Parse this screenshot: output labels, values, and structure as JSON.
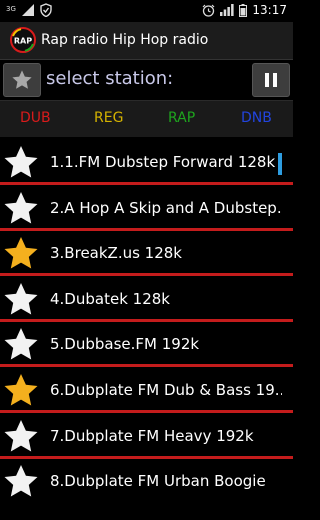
{
  "status_bar": {
    "network": "3G",
    "time": "13:17"
  },
  "app": {
    "logo_text": "RAP",
    "title": "Rap radio Hip Hop radio"
  },
  "toolbar": {
    "select_label": "select station:"
  },
  "genres": [
    {
      "label": "DUB",
      "color": "#d81b1b"
    },
    {
      "label": "REG",
      "color": "#d4b200"
    },
    {
      "label": "RAP",
      "color": "#1ea51e"
    },
    {
      "label": "DNB",
      "color": "#2244dd"
    }
  ],
  "stations": [
    {
      "label": "1.1.FM Dubstep Forward 128k",
      "favorite": false,
      "active": true
    },
    {
      "label": "2.A Hop A Skip and A Dubstep...",
      "favorite": false,
      "active": false
    },
    {
      "label": "3.BreakZ.us 128k",
      "favorite": true,
      "active": false
    },
    {
      "label": "4.Dubatek 128k",
      "favorite": false,
      "active": false
    },
    {
      "label": "5.Dubbase.FM 192k",
      "favorite": false,
      "active": false
    },
    {
      "label": "6.Dubplate FM Dub & Bass 19...",
      "favorite": true,
      "active": false
    },
    {
      "label": "7.Dubplate FM Heavy 192k",
      "favorite": false,
      "active": false
    },
    {
      "label": "8.Dubplate FM Urban Boogie",
      "favorite": false,
      "active": false
    }
  ],
  "colors": {
    "divider": "#c41c1c",
    "star_white": "#f2f2f2",
    "star_gold": "#f4b01e",
    "scroll_indicator": "#2e9de0"
  }
}
